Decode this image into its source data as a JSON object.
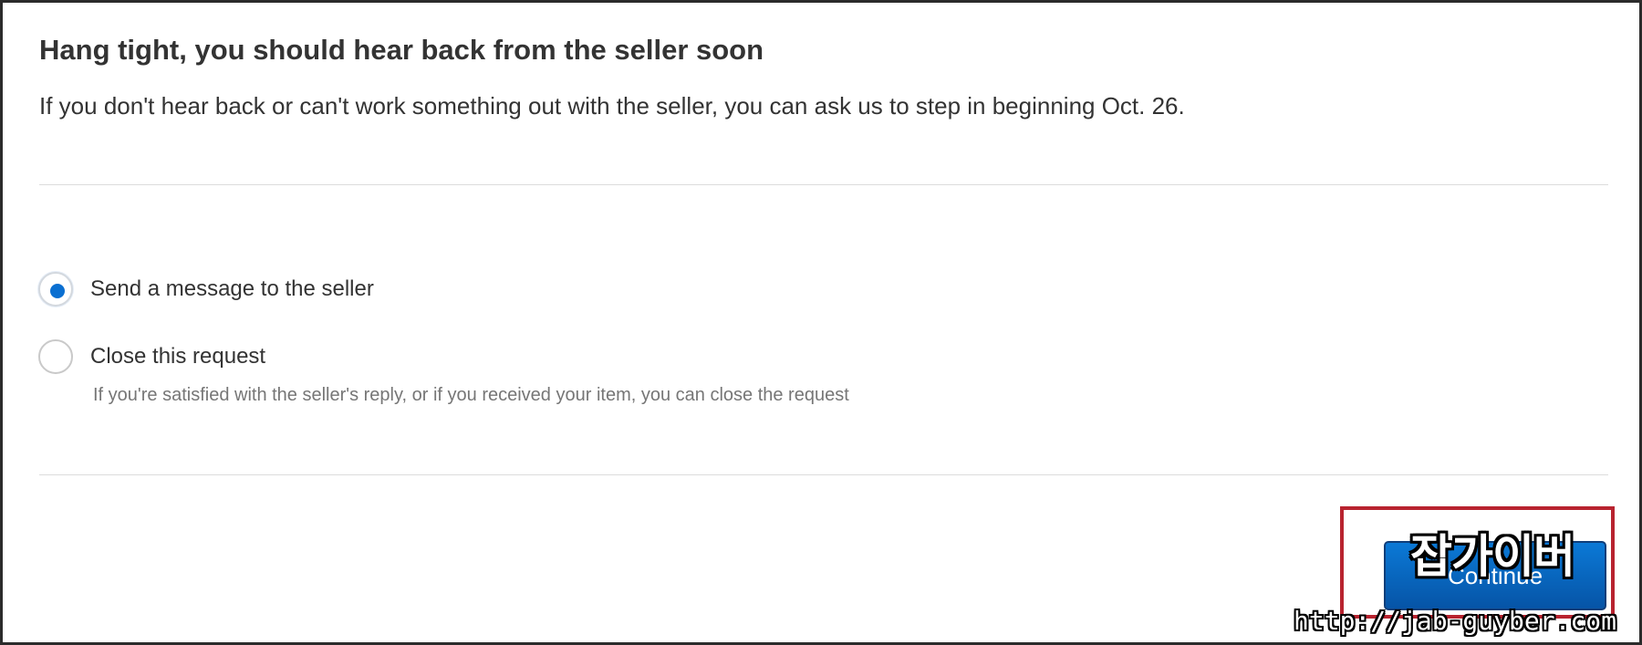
{
  "header": {
    "title": "Hang tight, you should hear back from the seller soon",
    "description": "If you don't hear back or can't work something out with the seller, you can ask us to step in beginning Oct. 26."
  },
  "options": [
    {
      "label": "Send a message to the seller",
      "selected": true,
      "icon": "radio-selected-icon"
    },
    {
      "label": "Close this request",
      "selected": false,
      "icon": "radio-unselected-icon",
      "help_text": "If you're satisfied with the seller's reply, or if you received your item, you can close the request"
    }
  ],
  "actions": {
    "continue_label": "Continue"
  },
  "overlay": {
    "watermark_text": "잡가이버",
    "url_text": "http://jab-guyber.com"
  },
  "colors": {
    "accent": "#0a6fd1",
    "button": "#0654a6",
    "highlight": "#b8232f",
    "text": "#333333",
    "muted_text": "#767676"
  }
}
